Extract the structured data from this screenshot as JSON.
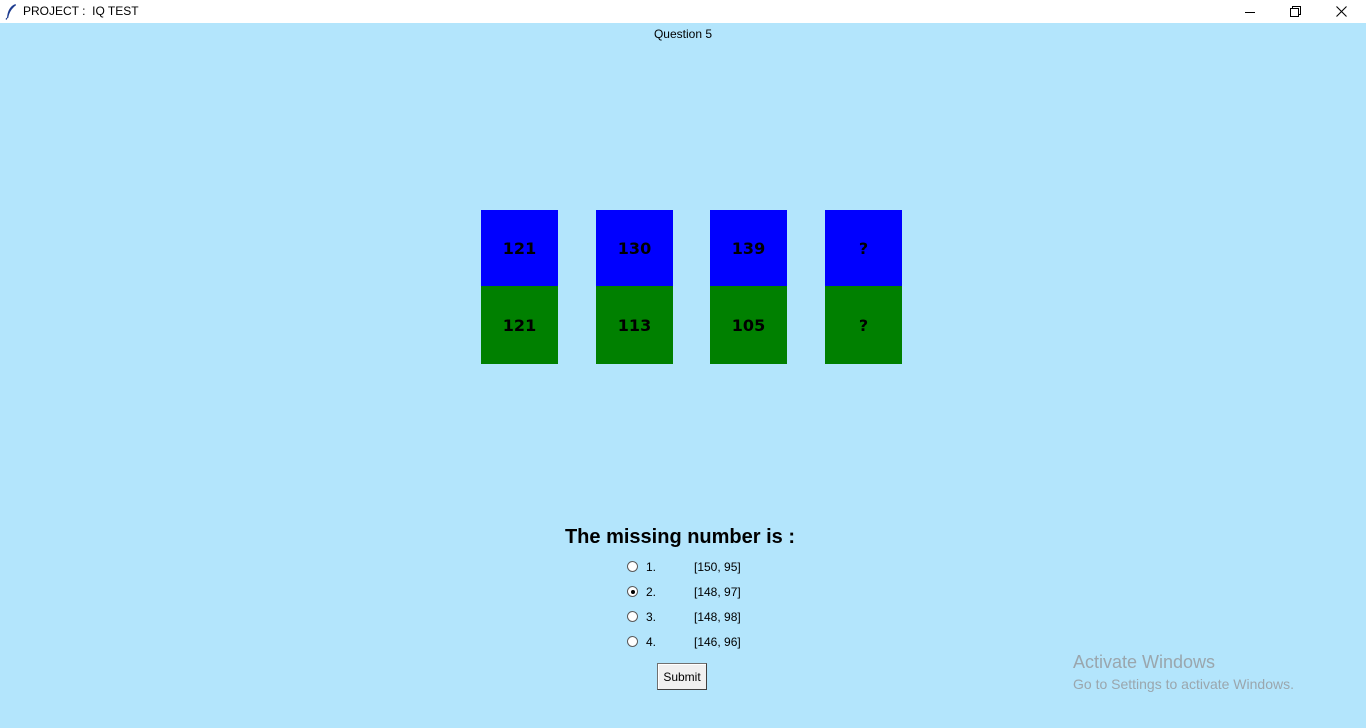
{
  "window": {
    "title": "PROJECT :  IQ TEST"
  },
  "question": {
    "label": "Question 5"
  },
  "cards": [
    {
      "top": "121",
      "bottom": "121"
    },
    {
      "top": "130",
      "bottom": "113"
    },
    {
      "top": "139",
      "bottom": "105"
    },
    {
      "top": "?",
      "bottom": "?"
    }
  ],
  "colors": {
    "background": "#b3e5fc",
    "card_top": "#0000ff",
    "card_bottom": "#008000"
  },
  "prompt": "The missing number is :",
  "options": [
    {
      "number": "1.",
      "value": "[150, 95]",
      "selected": false
    },
    {
      "number": "2.",
      "value": "[148, 97]",
      "selected": true
    },
    {
      "number": "3.",
      "value": "[148, 98]",
      "selected": false
    },
    {
      "number": "4.",
      "value": "[146, 96]",
      "selected": false
    }
  ],
  "submit_label": "Submit",
  "watermark": {
    "title": "Activate Windows",
    "subtitle": "Go to Settings to activate Windows."
  },
  "icons": {
    "app": "feather-icon",
    "minimize": "minimize-icon",
    "maximize": "restore-icon",
    "close": "close-icon"
  }
}
